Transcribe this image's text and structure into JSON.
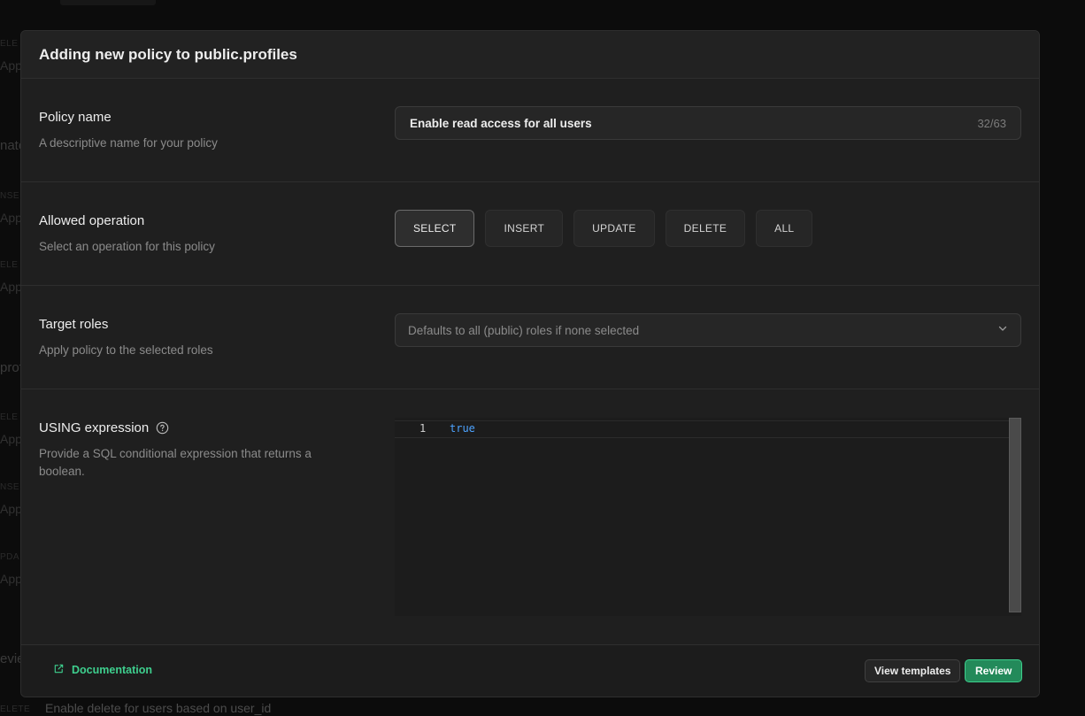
{
  "modal": {
    "title": "Adding new policy to public.profiles"
  },
  "policy_name": {
    "label": "Policy name",
    "description": "A descriptive name for your policy",
    "value": "Enable read access for all users",
    "counter": "32/63"
  },
  "allowed_operation": {
    "label": "Allowed operation",
    "description": "Select an operation for this policy",
    "options": [
      "SELECT",
      "INSERT",
      "UPDATE",
      "DELETE",
      "ALL"
    ],
    "selected": "SELECT"
  },
  "target_roles": {
    "label": "Target roles",
    "description": "Apply policy to the selected roles",
    "placeholder": "Defaults to all (public) roles if none selected"
  },
  "using_expression": {
    "label": "USING expression",
    "description": "Provide a SQL conditional expression that returns a boolean.",
    "line_number": "1",
    "code": "true"
  },
  "footer": {
    "documentation_label": "Documentation",
    "view_templates_label": "View templates",
    "review_label": "Review"
  },
  "background": {
    "bottom_row_tag": "ELETE",
    "bottom_row_text": "Enable delete for users based on user_id"
  },
  "icons": {
    "help": "help-circle-icon",
    "chevron": "chevron-down-icon",
    "external_link": "external-link-icon"
  },
  "colors": {
    "accent": "#3ecf8e",
    "review_bg": "#238a5a",
    "code_keyword": "#4da3ff"
  }
}
